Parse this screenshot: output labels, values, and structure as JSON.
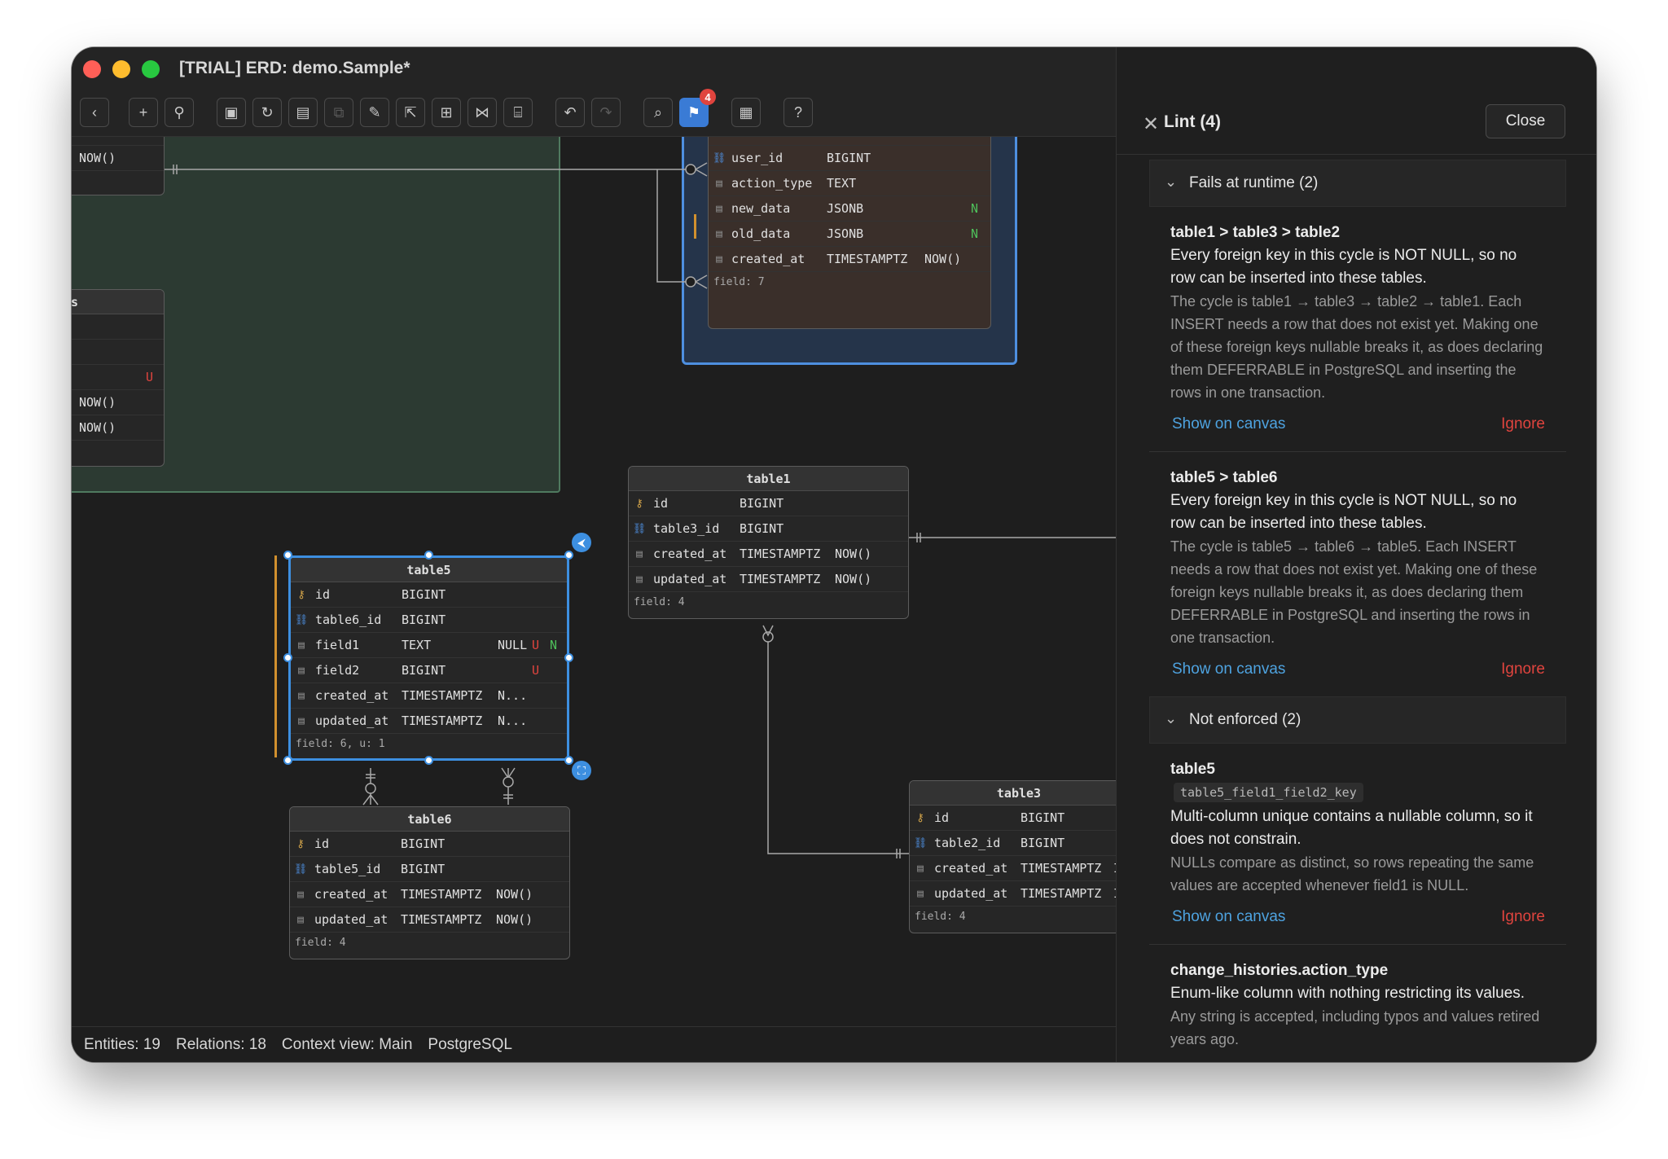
{
  "window": {
    "title": "[TRIAL] ERD: demo.Sample*"
  },
  "toolbar": {
    "buttons": [
      {
        "name": "back-icon",
        "glyph": "‹"
      },
      {
        "name": "add-icon",
        "glyph": "+"
      },
      {
        "name": "link-icon",
        "glyph": "⚲"
      },
      {
        "name": "save-icon",
        "glyph": "▣"
      },
      {
        "name": "refresh-icon",
        "glyph": "↻"
      },
      {
        "name": "table-icon",
        "glyph": "▤"
      },
      {
        "name": "copy-icon",
        "glyph": "⧉"
      },
      {
        "name": "edit-icon",
        "glyph": "✎"
      },
      {
        "name": "export-icon",
        "glyph": "⇱"
      },
      {
        "name": "grid-icon",
        "glyph": "⊞"
      },
      {
        "name": "share-icon",
        "glyph": "⋈"
      },
      {
        "name": "folder-icon",
        "glyph": "⌸"
      },
      {
        "name": "undo-icon",
        "glyph": "↶"
      },
      {
        "name": "redo-icon",
        "glyph": "↷"
      },
      {
        "name": "search-icon",
        "glyph": "⌕"
      },
      {
        "name": "lint-flag-icon",
        "glyph": "⚑"
      },
      {
        "name": "document-icon",
        "glyph": "▦"
      },
      {
        "name": "help-icon",
        "glyph": "?"
      }
    ],
    "lint_badge": "4"
  },
  "canvas": {
    "partial_left_top": {
      "rows": [
        "NOW()"
      ]
    },
    "partial_left_mid": {
      "header": "s",
      "flag": "U",
      "rows": [
        "NOW()",
        "NOW()"
      ]
    },
    "change_histories": {
      "rows": [
        {
          "name": "user_id",
          "type": "BIGINT",
          "default": "",
          "flag": ""
        },
        {
          "name": "action_type",
          "type": "TEXT",
          "default": "",
          "flag": ""
        },
        {
          "name": "new_data",
          "type": "JSONB",
          "default": "",
          "flag": "N"
        },
        {
          "name": "old_data",
          "type": "JSONB",
          "default": "",
          "flag": "N"
        },
        {
          "name": "created_at",
          "type": "TIMESTAMPTZ",
          "default": "NOW()",
          "flag": ""
        }
      ],
      "footer": "field: 7"
    },
    "table1": {
      "name": "table1",
      "rows": [
        {
          "name": "id",
          "type": "BIGINT",
          "default": ""
        },
        {
          "name": "table3_id",
          "type": "BIGINT",
          "default": ""
        },
        {
          "name": "created_at",
          "type": "TIMESTAMPTZ",
          "default": "NOW()"
        },
        {
          "name": "updated_at",
          "type": "TIMESTAMPTZ",
          "default": "NOW()"
        }
      ],
      "footer": "field: 4"
    },
    "table5": {
      "name": "table5",
      "rows": [
        {
          "name": "id",
          "type": "BIGINT",
          "default": "",
          "u": "",
          "n": ""
        },
        {
          "name": "table6_id",
          "type": "BIGINT",
          "default": "",
          "u": "",
          "n": ""
        },
        {
          "name": "field1",
          "type": "TEXT",
          "default": "NULL",
          "u": "U",
          "n": "N"
        },
        {
          "name": "field2",
          "type": "BIGINT",
          "default": "",
          "u": "U",
          "n": ""
        },
        {
          "name": "created_at",
          "type": "TIMESTAMPTZ",
          "default": "N...",
          "u": "",
          "n": ""
        },
        {
          "name": "updated_at",
          "type": "TIMESTAMPTZ",
          "default": "N...",
          "u": "",
          "n": ""
        }
      ],
      "footer": "field: 6, u: 1"
    },
    "table6": {
      "name": "table6",
      "rows": [
        {
          "name": "id",
          "type": "BIGINT",
          "default": ""
        },
        {
          "name": "table5_id",
          "type": "BIGINT",
          "default": ""
        },
        {
          "name": "created_at",
          "type": "TIMESTAMPTZ",
          "default": "NOW()"
        },
        {
          "name": "updated_at",
          "type": "TIMESTAMPTZ",
          "default": "NOW()"
        }
      ],
      "footer": "field: 4"
    },
    "table3": {
      "name": "table3",
      "rows": [
        {
          "name": "id",
          "type": "BIGINT",
          "default": ""
        },
        {
          "name": "table2_id",
          "type": "BIGINT",
          "default": ""
        },
        {
          "name": "created_at",
          "type": "TIMESTAMPTZ",
          "default": "I"
        },
        {
          "name": "updated_at",
          "type": "TIMESTAMPTZ",
          "default": "I"
        }
      ],
      "footer": "field: 4"
    }
  },
  "status": {
    "entities": "Entities: 19",
    "relations": "Relations: 18",
    "context": "Context view: Main",
    "dialect": "PostgreSQL"
  },
  "lint": {
    "title": "Lint (4)",
    "close_label": "Close",
    "groups": [
      {
        "label": "Fails at runtime (2)",
        "issues": [
          {
            "title": "table1 > table3 > table2",
            "code": "",
            "summary": "Every foreign key in this cycle is NOT NULL, so no row can be inserted into these tables.",
            "detail": "The cycle is table1 → table3 → table2 → table1. Each INSERT needs a row that does not exist yet. Making one of these foreign keys nullable breaks it, as does declaring them DEFERRABLE in PostgreSQL and inserting the rows in one transaction.",
            "show": "Show on canvas",
            "ignore": "Ignore"
          },
          {
            "title": "table5 > table6",
            "code": "",
            "summary": "Every foreign key in this cycle is NOT NULL, so no row can be inserted into these tables.",
            "detail": "The cycle is table5 → table6 → table5. Each INSERT needs a row that does not exist yet. Making one of these foreign keys nullable breaks it, as does declaring them DEFERRABLE in PostgreSQL and inserting the rows in one transaction.",
            "show": "Show on canvas",
            "ignore": "Ignore"
          }
        ]
      },
      {
        "label": "Not enforced (2)",
        "issues": [
          {
            "title": "table5",
            "code": "table5_field1_field2_key",
            "summary": "Multi-column unique contains a nullable column, so it does not constrain.",
            "detail": "NULLs compare as distinct, so rows repeating the same values are accepted whenever field1 is NULL.",
            "show": "Show on canvas",
            "ignore": "Ignore"
          },
          {
            "title": "change_histories.action_type",
            "code": "",
            "summary": "Enum-like column with nothing restricting its values.",
            "detail": "Any string is accepted, including typos and values retired years ago.",
            "show": "",
            "ignore": ""
          }
        ]
      }
    ]
  },
  "colors": {
    "accent": "#3d8fe0",
    "link": "#4ea3e0",
    "danger": "#e0443e",
    "group_green": "#2c3a32",
    "group_blue": "#25344a"
  }
}
